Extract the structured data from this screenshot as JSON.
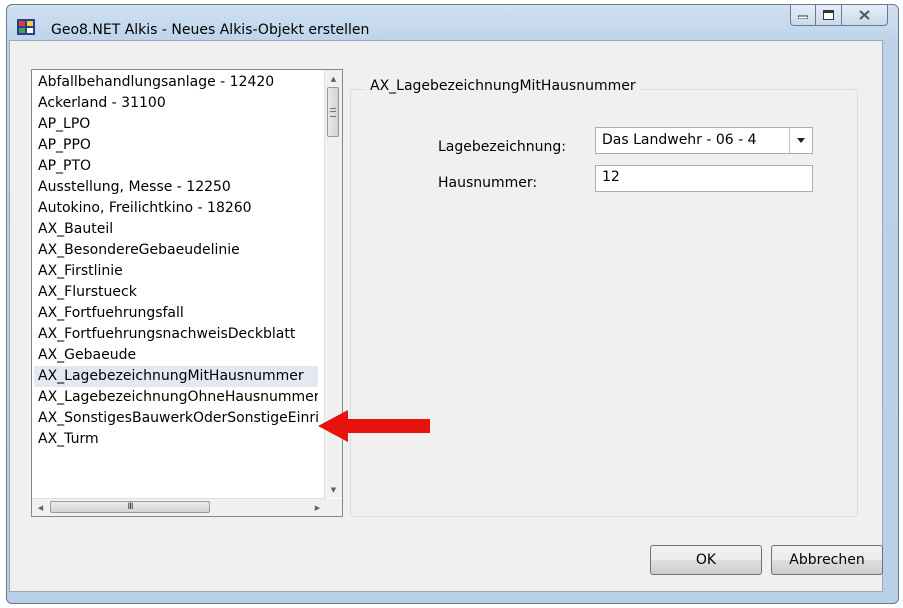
{
  "window": {
    "title": "Geo8.NET Alkis - Neues Alkis-Objekt erstellen",
    "controls": {
      "minimize": "minimize-icon",
      "maximize": "maximize-icon",
      "close": "close-icon"
    }
  },
  "object_list": {
    "items": [
      "Abfallbehandlungsanlage - 12420",
      "Ackerland - 31100",
      "AP_LPO",
      "AP_PPO",
      "AP_PTO",
      "Ausstellung, Messe - 12250",
      "Autokino, Freilichtkino - 18260",
      "AX_Bauteil",
      "AX_BesondereGebaeudelinie",
      "AX_Firstlinie",
      "AX_Flurstueck",
      "AX_Fortfuehrungsfall",
      "AX_FortfuehrungsnachweisDeckblatt",
      "AX_Gebaeude",
      "AX_LagebezeichnungMitHausnummer",
      "AX_LagebezeichnungOhneHausnummer",
      "AX_SonstigesBauwerkOderSonstigeEinrichtung",
      "AX_Turm"
    ],
    "selected": "AX_LagebezeichnungMitHausnummer"
  },
  "group": {
    "title": "AX_LagebezeichnungMitHausnummer",
    "lagebezeichnung_label": "Lagebezeichnung:",
    "lagebezeichnung_value": "Das Landwehr - 06 - 4",
    "hausnummer_label": "Hausnummer:",
    "hausnummer_value": "12"
  },
  "buttons": {
    "ok": "OK",
    "cancel": "Abbrechen"
  },
  "colors": {
    "annotation_arrow": "#e8120c",
    "selection": "#e3e9f3"
  }
}
